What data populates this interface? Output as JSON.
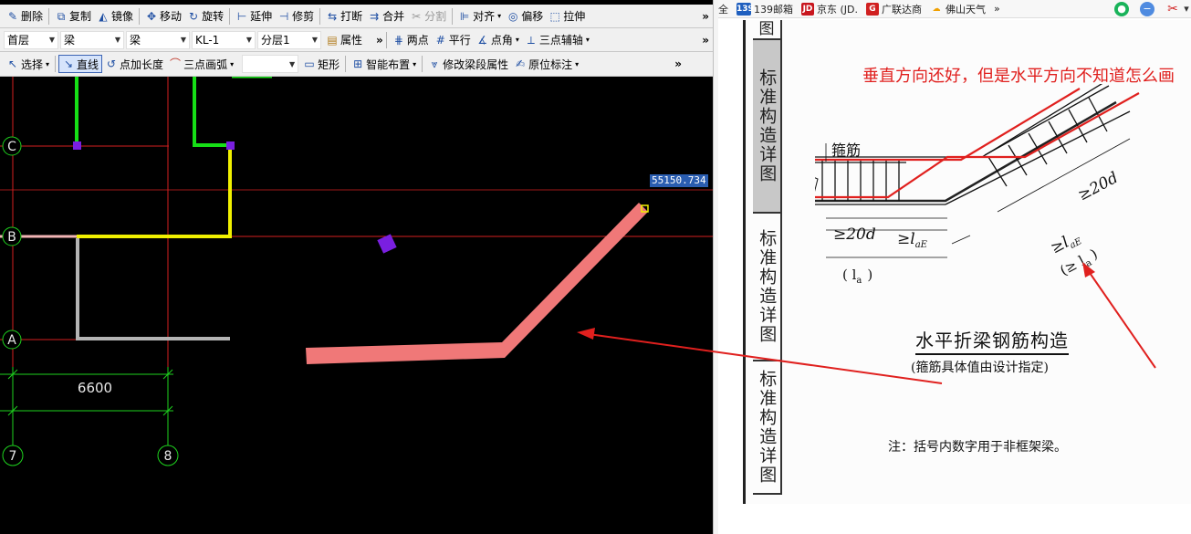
{
  "cad_app": {
    "toolbar1": [
      {
        "label": "删除",
        "icon": "eraser-icon"
      },
      {
        "label": "复制",
        "icon": "copy-icon"
      },
      {
        "label": "镜像",
        "icon": "mirror-icon"
      },
      {
        "label": "移动",
        "icon": "move-icon"
      },
      {
        "label": "旋转",
        "icon": "rotate-icon"
      },
      {
        "label": "延伸",
        "icon": "extend-icon"
      },
      {
        "label": "修剪",
        "icon": "trim-icon"
      },
      {
        "label": "打断",
        "icon": "break-icon"
      },
      {
        "label": "合并",
        "icon": "merge-icon"
      },
      {
        "label": "分割",
        "icon": "split-icon",
        "disabled": true
      },
      {
        "label": "对齐",
        "icon": "align-icon"
      },
      {
        "label": "偏移",
        "icon": "offset-icon"
      },
      {
        "label": "拉伸",
        "icon": "stretch-icon"
      }
    ],
    "toolbar2": {
      "floor_select": "首层",
      "category_select": "梁",
      "type_select": "梁",
      "component_select": "KL-1",
      "layer_select": "分层1",
      "properties_label": "属性",
      "two_point_label": "两点",
      "parallel_label": "平行",
      "point_angle_label": "点角",
      "three_point_axis_label": "三点辅轴"
    },
    "toolbar3": {
      "select_label": "选择",
      "line_label": "直线",
      "point_length_label": "点加长度",
      "three_point_arc_label": "三点画弧",
      "rect_label": "矩形",
      "smart_layout_label": "智能布置",
      "modify_segment_label": "修改梁段属性",
      "origin_mark_label": "原位标注"
    },
    "canvas": {
      "axis_c": "C",
      "axis_b": "B",
      "axis_a": "A",
      "axis_7": "7",
      "axis_8": "8",
      "dimension": "6600",
      "coordinate_readout": "55150.734",
      "colors": {
        "grid": "#d42020",
        "beam_green": "#16e016",
        "beam_yellow": "#f0f000",
        "beam_gray": "#b4b4b4",
        "beam_pink": "#f07878",
        "node_purple": "#7a1fe0"
      }
    }
  },
  "browser": {
    "bookmarks": [
      {
        "label": "全",
        "icon": ""
      },
      {
        "label": "139邮箱",
        "icon": "139-mail-icon"
      },
      {
        "label": "京东 (JD.",
        "icon": "jd-icon"
      },
      {
        "label": "广联达商",
        "icon": "glodon-icon"
      },
      {
        "label": "佛山天气",
        "icon": "weather-icon"
      },
      {
        "label": "»",
        "icon": ""
      }
    ]
  },
  "document": {
    "side_tab_top": "图",
    "side_tab_2": "标准构造详图",
    "side_tab_3": "标准构造详图",
    "side_tab_4": "标准构造详图",
    "annotation": "垂直方向还好，但是水平方向不知道怎么画",
    "figure": {
      "stirrup_label": "箍筋",
      "b_label": "b",
      "d20_left": "≥20d",
      "lae_left": "≥l",
      "lae_sub_left": "aE",
      "la_left": "( l",
      "la_sub_left": "a",
      "la_close": ")",
      "d20_right": "≥20d",
      "lae_right": "≥l",
      "lae_sub_right": "aE",
      "la_right": "(≥ l",
      "la_sub_right": "a",
      "la_right_close": ")"
    },
    "title": "水平折梁钢筋构造",
    "subtitle": "(箍筋具体值由设计指定)",
    "note": "注：括号内数字用于非框架梁。"
  }
}
